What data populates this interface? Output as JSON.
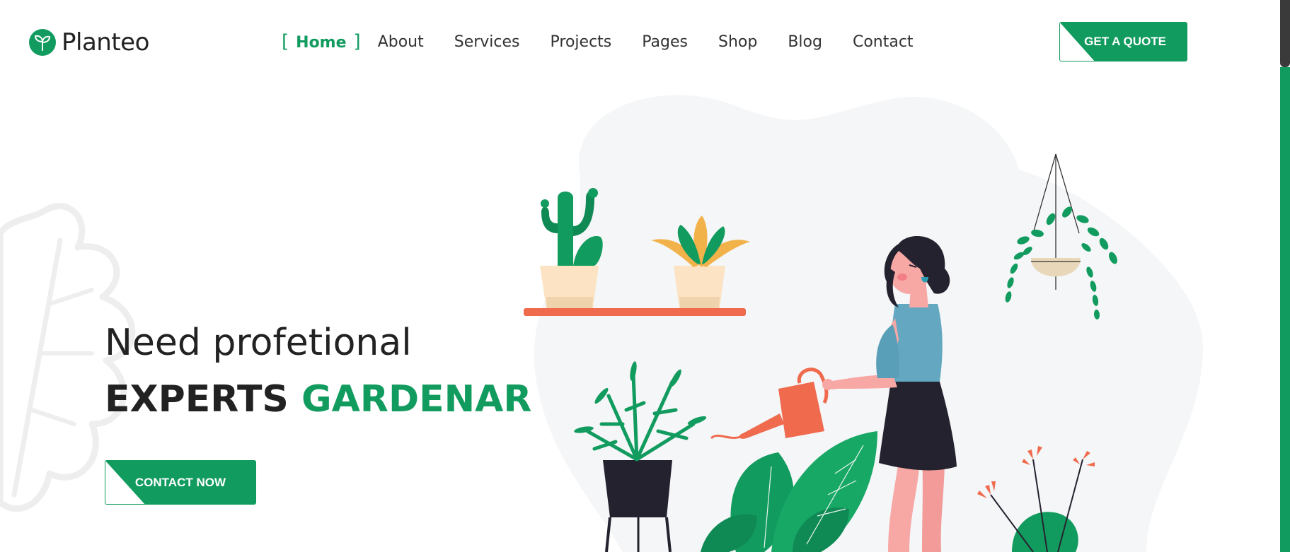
{
  "brand": {
    "name": "Planteo",
    "accent": "#129b5f"
  },
  "nav": {
    "items": [
      {
        "label": "Home",
        "active": true
      },
      {
        "label": "About"
      },
      {
        "label": "Services"
      },
      {
        "label": "Projects"
      },
      {
        "label": "Pages"
      },
      {
        "label": "Shop"
      },
      {
        "label": "Blog"
      },
      {
        "label": "Contact"
      }
    ],
    "active_brackets": {
      "left": "[",
      "right": "]"
    }
  },
  "header": {
    "cta_label": "GET A QUOTE"
  },
  "hero": {
    "line1": "Need profetional",
    "line2_main": "EXPERTS",
    "line2_accent": "GARDENAR",
    "cta_label": "CONTACT NOW"
  },
  "icons": {
    "logo": "sprout-icon",
    "illustration": "woman-watering-plants-illustration"
  }
}
